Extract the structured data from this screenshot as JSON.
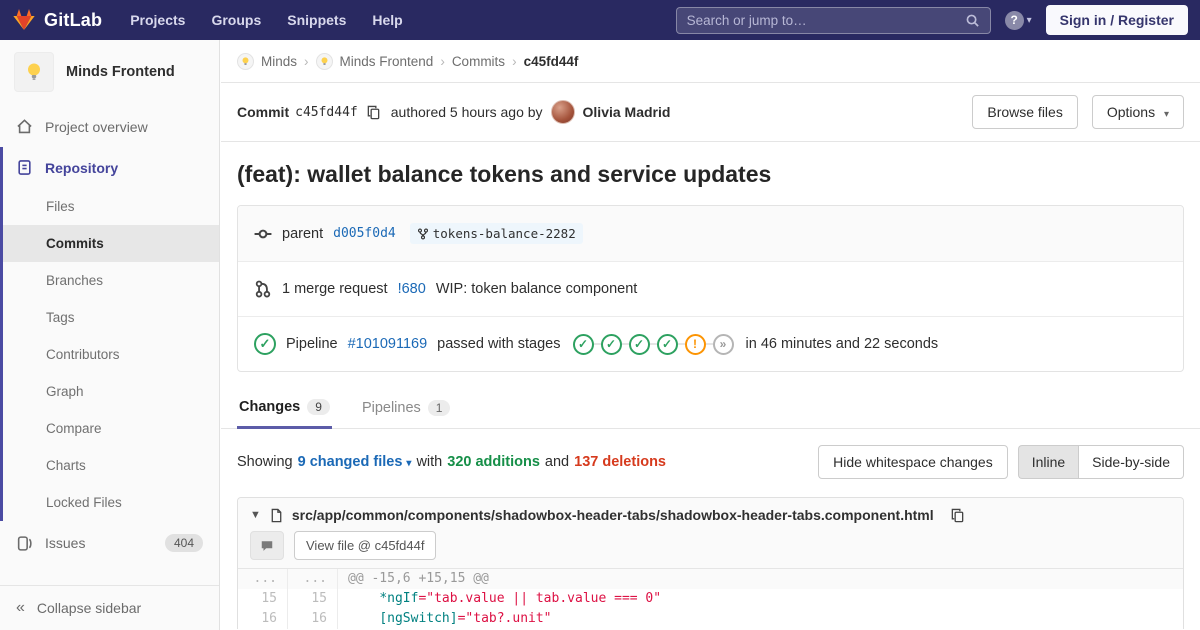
{
  "navbar": {
    "brand": "GitLab",
    "menu": [
      "Projects",
      "Groups",
      "Snippets",
      "Help"
    ],
    "search_placeholder": "Search or jump to…",
    "help_glyph": "?",
    "sign_in_label": "Sign in / Register"
  },
  "sidebar": {
    "project_name": "Minds Frontend",
    "project_overview": "Project overview",
    "repository": "Repository",
    "repository_items": [
      {
        "label": "Files",
        "active": false
      },
      {
        "label": "Commits",
        "active": true
      },
      {
        "label": "Branches",
        "active": false
      },
      {
        "label": "Tags",
        "active": false
      },
      {
        "label": "Contributors",
        "active": false
      },
      {
        "label": "Graph",
        "active": false
      },
      {
        "label": "Compare",
        "active": false
      },
      {
        "label": "Charts",
        "active": false
      },
      {
        "label": "Locked Files",
        "active": false
      }
    ],
    "issues": "Issues",
    "issues_count": "404",
    "collapse": "Collapse sidebar"
  },
  "breadcrumb": {
    "items": [
      "Minds",
      "Minds Frontend",
      "Commits"
    ],
    "current": "c45fd44f",
    "separator": "›"
  },
  "commit_header": {
    "label": "Commit",
    "sha": "c45fd44f",
    "authored": "authored 5 hours ago by",
    "author": "Olivia Madrid",
    "browse_files": "Browse files",
    "options": "Options"
  },
  "commit": {
    "title": "(feat): wallet balance tokens and service updates",
    "parent_label": "parent",
    "parent_sha": "d005f0d4",
    "ref": "tokens-balance-2282",
    "mr_count_text": "1 merge request",
    "mr_id": "!680",
    "mr_title": "WIP: token balance component",
    "pipeline_label": "Pipeline",
    "pipeline_id": "#101091169",
    "pipeline_status_text": "passed with stages",
    "pipeline_stages": [
      "passed",
      "passed",
      "passed",
      "passed",
      "warning",
      "skipped"
    ],
    "pipeline_duration": "in 46 minutes and 22 seconds"
  },
  "tabs": [
    {
      "label": "Changes",
      "count": "9",
      "active": true
    },
    {
      "label": "Pipelines",
      "count": "1",
      "active": false
    }
  ],
  "changes_bar": {
    "showing": "Showing",
    "files_link": "9 changed files",
    "with_word": "with",
    "additions": "320 additions",
    "and_word": "and",
    "deletions": "137 deletions",
    "hide_whitespace": "Hide whitespace changes",
    "inline": "Inline",
    "side_by_side": "Side-by-side"
  },
  "diff": {
    "file_path": "src/app/common/components/shadowbox-header-tabs/shadowbox-header-tabs.component.html",
    "view_file": "View file @ c45fd44f",
    "lines": [
      {
        "old": "...",
        "new": "...",
        "type": "match",
        "code": "@@ -15,6 +15,15 @@"
      },
      {
        "old": "15",
        "new": "15",
        "type": "code",
        "indent": "    ",
        "attr": "*ngIf",
        "value": "=\"tab.value || tab.value === 0\""
      },
      {
        "old": "16",
        "new": "16",
        "type": "code",
        "indent": "    ",
        "attr": "[ngSwitch]",
        "value": "=\"tab?.unit\""
      }
    ]
  },
  "colors": {
    "navbar_bg": "#292961",
    "accent_indigo": "#5c5ca8",
    "link_blue": "#1b69b6",
    "success_green": "#2da160",
    "warning_orange": "#fc9403",
    "additions_green": "#168f48",
    "deletions_red": "#d63a1d",
    "code_attr": "#008080",
    "code_string": "#d14"
  }
}
